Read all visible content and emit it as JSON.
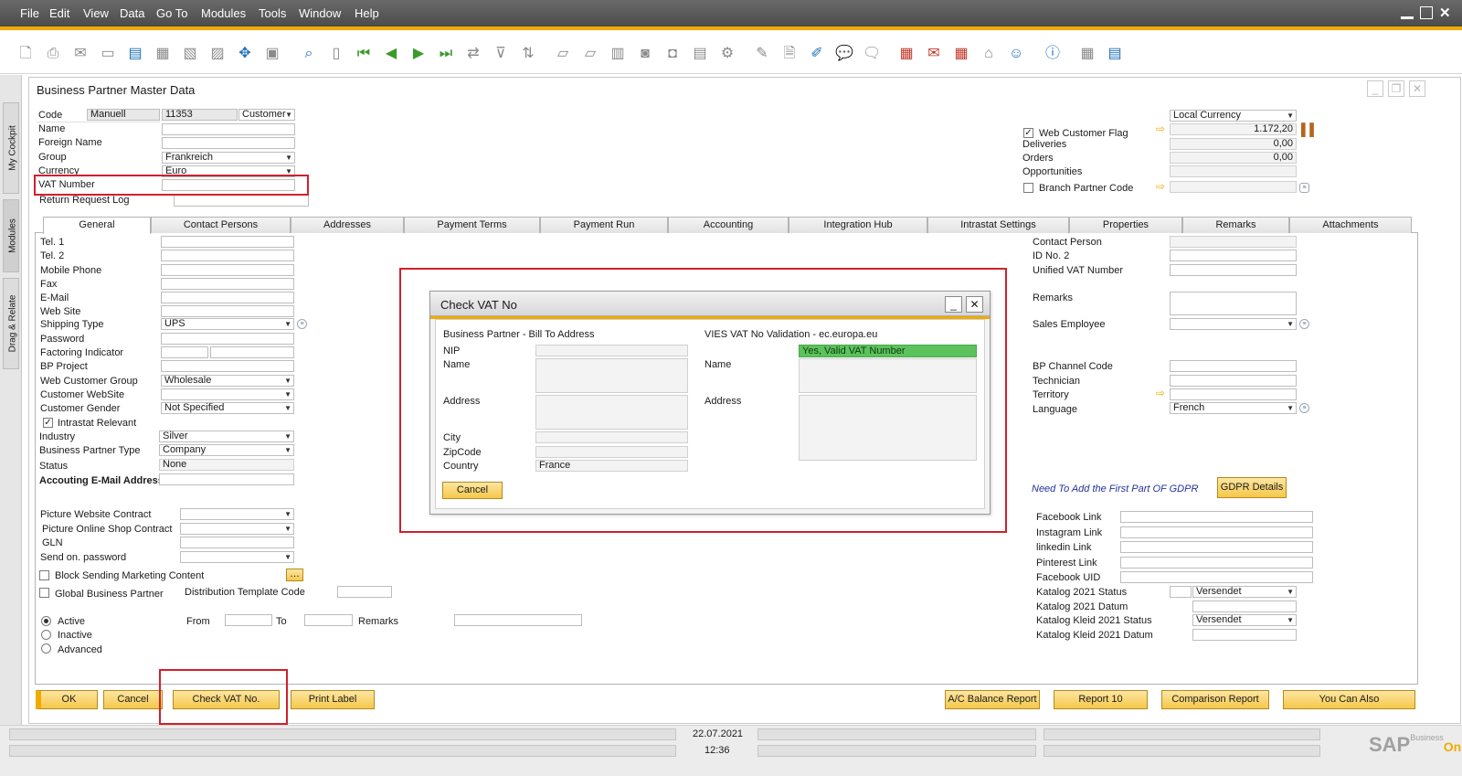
{
  "menu": [
    "File",
    "Edit",
    "View",
    "Data",
    "Go To",
    "Modules",
    "Tools",
    "Window",
    "Help"
  ],
  "side_tabs": [
    "My Cockpit",
    "Modules",
    "Drag & Relate"
  ],
  "window_title": "Business Partner Master Data",
  "header": {
    "code_label": "Code",
    "code_value": "Manuell",
    "code_number": "11353",
    "type_value": "Customer",
    "name_label": "Name",
    "foreign_name_label": "Foreign Name",
    "group_label": "Group",
    "group_value": "Frankreich",
    "currency_label": "Currency",
    "currency_value": "Euro",
    "vat_label": "VAT Number",
    "return_label": "Return Request Log",
    "local_currency": "Local Currency",
    "web_customer_flag": "Web Customer Flag",
    "balance": "1.172,20",
    "deliveries_label": "Deliveries",
    "deliveries_value": "0,00",
    "orders_label": "Orders",
    "orders_value": "0,00",
    "opportunities_label": "Opportunities",
    "branch_label": "Branch Partner Code"
  },
  "tabs": [
    "General",
    "Contact Persons",
    "Addresses",
    "Payment Terms",
    "Payment Run",
    "Accounting",
    "Integration Hub",
    "Intrastat Settings",
    "Properties",
    "Remarks",
    "Attachments"
  ],
  "general_left": {
    "tel1": "Tel. 1",
    "tel2": "Tel. 2",
    "mobile": "Mobile Phone",
    "fax": "Fax",
    "email": "E-Mail",
    "website": "Web Site",
    "shipping_label": "Shipping Type",
    "shipping_value": "UPS",
    "password": "Password",
    "factoring": "Factoring Indicator",
    "bp_project": "BP Project",
    "web_group_label": "Web Customer Group",
    "web_group_value": "Wholesale",
    "customer_website": "Customer WebSite",
    "gender_label": "Customer Gender",
    "gender_value": "Not Specified",
    "intrastat": "Intrastat Relevant",
    "industry_label": "Industry",
    "industry_value": "Silver",
    "bp_type_label": "Business Partner Type",
    "bp_type_value": "Company",
    "status_label": "Status",
    "status_value": "None",
    "acc_email": "Accouting E-Mail Address",
    "pic_website": "Picture Website Contract",
    "pic_shop": "Picture Online Shop Contract",
    "gln": "GLN",
    "send_pw": "Send on. password",
    "block_marketing": "Block Sending Marketing Content",
    "global_bp": "Global Business Partner",
    "dist_template": "Distribution Template Code",
    "active": "Active",
    "inactive": "Inactive",
    "advanced": "Advanced",
    "from": "From",
    "to": "To",
    "remarks": "Remarks"
  },
  "general_right": {
    "contact_person": "Contact Person",
    "id_no2": "ID No. 2",
    "unified_vat": "Unified VAT Number",
    "remarks": "Remarks",
    "sales_employee": "Sales Employee",
    "bp_channel": "BP Channel Code",
    "technician": "Technician",
    "territory": "Territory",
    "language_label": "Language",
    "language_value": "French",
    "gdpr_note": "Need To Add the First Part OF GDPR",
    "gdpr_button": "GDPR Details",
    "facebook": "Facebook Link",
    "instagram": "Instagram Link",
    "linkedin": "linkedin Link",
    "pinterest": "Pinterest Link",
    "facebook_uid": "Facebook UID",
    "katalog_status": "Katalog 2021 Status",
    "katalog_status_value": "Versendet",
    "katalog_datum": "Katalog 2021 Datum",
    "kleid_status": "Katalog Kleid 2021 Status",
    "kleid_status_value": "Versendet",
    "kleid_datum": "Katalog Kleid 2021 Datum"
  },
  "dialog": {
    "title": "Check VAT No",
    "left_header": "Business Partner - Bill To Address",
    "nip": "NIP",
    "name": "Name",
    "address": "Address",
    "city": "City",
    "zipcode": "ZipCode",
    "country": "Country",
    "country_value": "France",
    "right_header": "VIES VAT No Validation - ec.europa.eu",
    "valid_text": "Yes, Valid VAT Number",
    "r_name": "Name",
    "r_address": "Address",
    "cancel": "Cancel"
  },
  "buttons": {
    "ok": "OK",
    "cancel": "Cancel",
    "check_vat": "Check VAT No.",
    "print_label": "Print Label",
    "ac_balance": "A/C Balance Report",
    "report10": "Report 10",
    "comparison": "Comparison Report",
    "you_can_also": "You Can Also"
  },
  "status": {
    "date": "22.07.2021",
    "time": "12:36"
  },
  "logo": {
    "sap": "SAP",
    "business": "Business",
    "one": "One"
  }
}
